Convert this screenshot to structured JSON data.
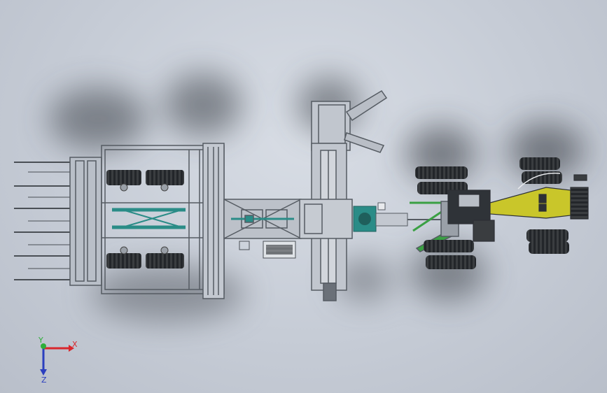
{
  "axes": {
    "x_label": "X",
    "y_label": "Y",
    "z_label": "Z",
    "x_color": "#d9262c",
    "y_color": "#2fae3a",
    "z_color": "#2b3fbf"
  },
  "colors": {
    "frame": "#555b62",
    "teal": "#2a8c87",
    "tire": "#3a3d40",
    "yellow": "#c9c62a",
    "green": "#3aa043"
  }
}
